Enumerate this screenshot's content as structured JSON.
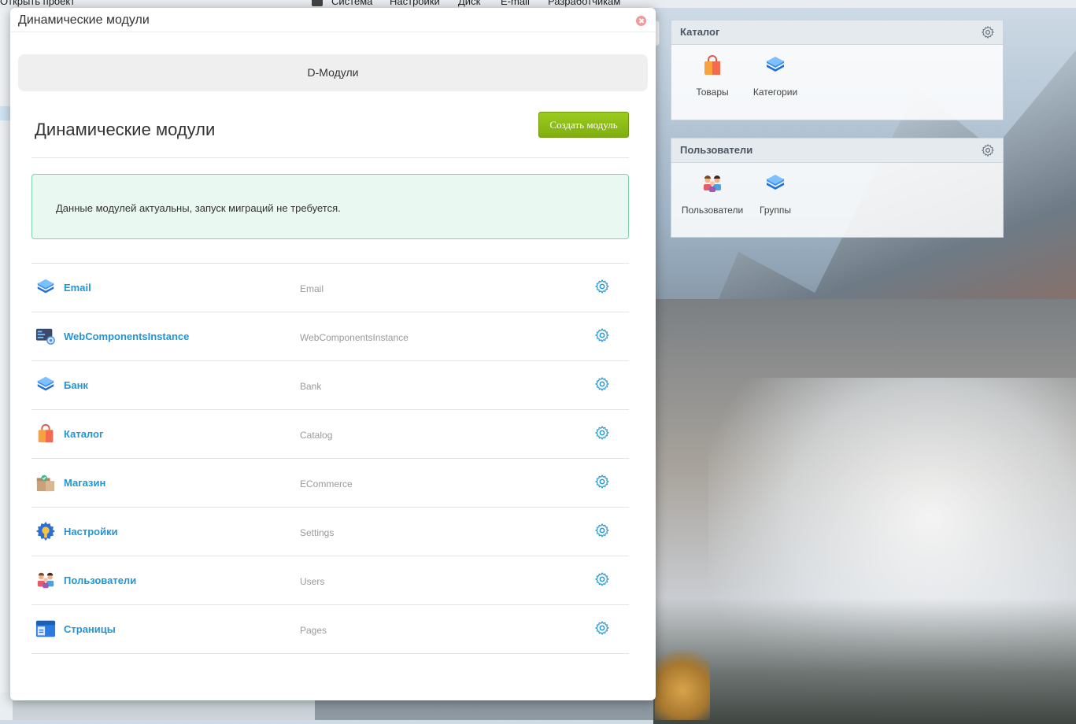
{
  "menubar": {
    "open_project": "Открыть проект",
    "items": [
      "Система",
      "Настройки",
      "Диск",
      "E-mail",
      "Разработчикам"
    ]
  },
  "panels": {
    "catalog": {
      "title": "Каталог",
      "items": [
        {
          "label": "Товары",
          "icon": "shopping-bag-icon"
        },
        {
          "label": "Категории",
          "icon": "layers-icon"
        }
      ]
    },
    "users": {
      "title": "Пользователи",
      "items": [
        {
          "label": "Пользователи",
          "icon": "users-icon"
        },
        {
          "label": "Группы",
          "icon": "layers-icon"
        }
      ]
    }
  },
  "dialog": {
    "title": "Динамические модули",
    "tab": "D-Модули",
    "heading": "Динамические модули",
    "create_button": "Создать модуль",
    "alert": "Данные модулей актуальны, запуск миграций не требуется.",
    "modules": [
      {
        "name": "Email",
        "code": "Email",
        "icon": "layers-icon"
      },
      {
        "name": "WebComponentsInstance",
        "code": "WebComponentsInstance",
        "icon": "web-component-icon"
      },
      {
        "name": "Банк",
        "code": "Bank",
        "icon": "layers-icon"
      },
      {
        "name": "Каталог",
        "code": "Catalog",
        "icon": "shopping-bag-icon"
      },
      {
        "name": "Магазин",
        "code": "ECommerce",
        "icon": "box-icon"
      },
      {
        "name": "Настройки",
        "code": "Settings",
        "icon": "settings-icon"
      },
      {
        "name": "Пользователи",
        "code": "Users",
        "icon": "users-icon"
      },
      {
        "name": "Страницы",
        "code": "Pages",
        "icon": "pages-icon"
      }
    ]
  },
  "colors": {
    "link": "#2196d3",
    "create_button": "#8bbd17",
    "alert_bg": "#e9f8f1",
    "alert_border": "#7fd4ab"
  }
}
